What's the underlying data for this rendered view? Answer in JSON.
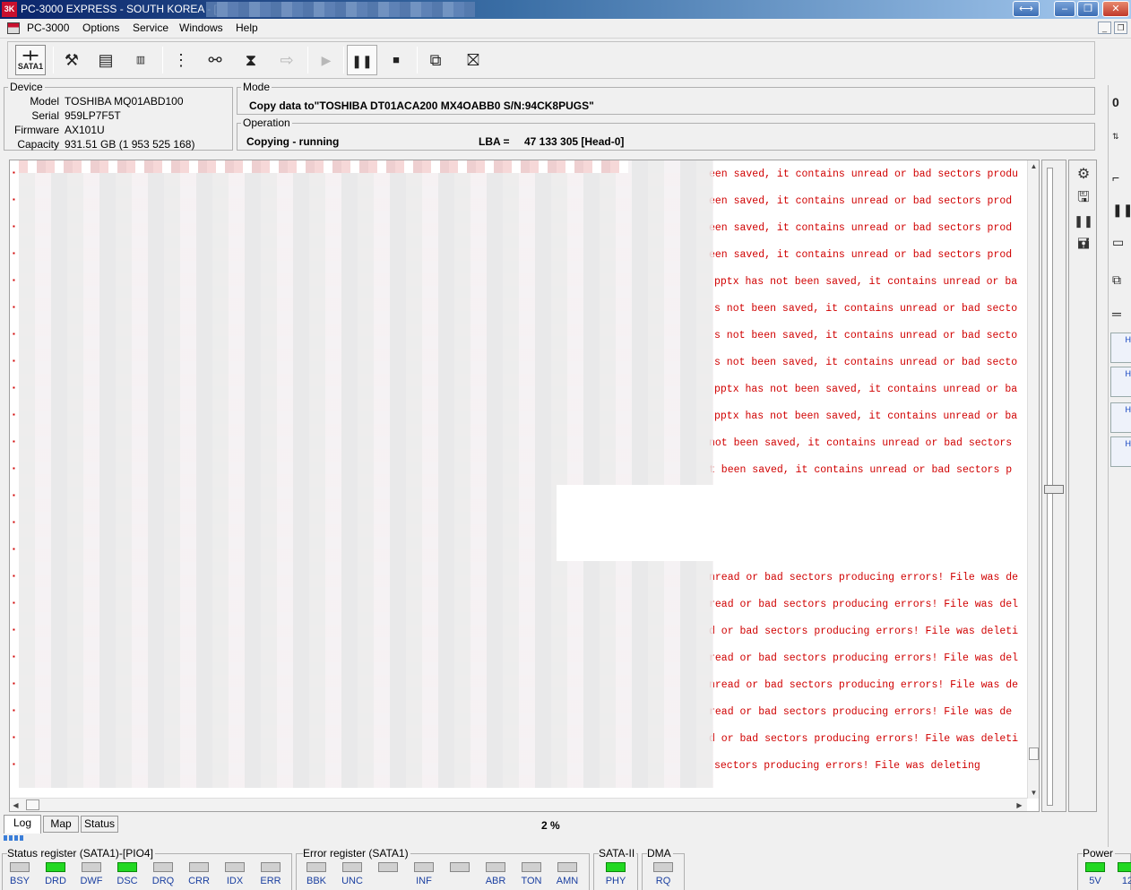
{
  "window": {
    "title": "PC-3000 EXPRESS - SOUTH KOREA - [",
    "logo_text": "3K"
  },
  "menu": [
    "PC-3000",
    "Options",
    "Service",
    "Windows",
    "Help"
  ],
  "toolbar": {
    "sata_label": "SATA1"
  },
  "device": {
    "legend": "Device",
    "model_label": "Model",
    "model": "TOSHIBA MQ01ABD100",
    "serial_label": "Serial",
    "serial": "959LP7F5T",
    "firmware_label": "Firmware",
    "firmware": "AX101U",
    "capacity_label": "Capacity",
    "capacity": "931.51 GB (1 953 525 168)"
  },
  "mode": {
    "legend": "Mode",
    "value": "Copy data to\"TOSHIBA DT01ACA200 MX4OABB0 S/N:94CK8PUGS\""
  },
  "operation": {
    "legend": "Operation",
    "status": "Copying - running",
    "lba_label": "LBA =",
    "lba_value": "47 133 305  [Head-0]"
  },
  "log": {
    "lines": [
      "een saved, it contains unread or bad sectors produ",
      "een saved, it contains unread or bad sectors prod",
      "een saved, it contains unread or bad sectors prod",
      "een saved, it contains unread or bad sectors prod",
      "pptx has not been saved, it contains unread or ba",
      "s not been saved, it contains unread or bad secto",
      "s not been saved, it contains unread or bad secto",
      "s not been saved, it contains unread or bad secto",
      "pptx has not been saved, it contains unread or ba",
      "pptx has not been saved, it contains unread or ba",
      "not been saved, it contains unread or bad sectors",
      "t been saved, it contains unread or bad sectors p",
      "",
      "",
      "",
      "nread or bad sectors producing errors! File was de",
      "read or bad sectors producing errors! File was del",
      "d or bad sectors producing errors! File was deleti",
      "read or bad sectors producing errors! File was del",
      "nread or bad sectors producing errors! File was de",
      "read or bad sectors producing errors! File was de",
      "d or bad sectors producing errors! File was deleti",
      " sectors producing errors! File was deleting"
    ]
  },
  "tabs": [
    "Log",
    "Map",
    "Status"
  ],
  "progress": {
    "label": "2 %",
    "value_percent": 2
  },
  "status_register": {
    "label": "Status register (SATA1)-[PIO4]",
    "flags": [
      {
        "name": "BSY",
        "on": false
      },
      {
        "name": "DRD",
        "on": true
      },
      {
        "name": "DWF",
        "on": false
      },
      {
        "name": "DSC",
        "on": true
      },
      {
        "name": "DRQ",
        "on": false
      },
      {
        "name": "CRR",
        "on": false
      },
      {
        "name": "IDX",
        "on": false
      },
      {
        "name": "ERR",
        "on": false
      }
    ]
  },
  "error_register": {
    "label": "Error register (SATA1)",
    "flags": [
      {
        "name": "BBK",
        "on": false
      },
      {
        "name": "UNC",
        "on": false
      },
      {
        "name": "",
        "on": false
      },
      {
        "name": "INF",
        "on": false
      },
      {
        "name": "",
        "on": false
      },
      {
        "name": "ABR",
        "on": false
      },
      {
        "name": "TON",
        "on": false
      },
      {
        "name": "AMN",
        "on": false
      }
    ]
  },
  "sata2": {
    "label": "SATA-II",
    "flag": {
      "name": "PHY",
      "on": true
    }
  },
  "dma": {
    "label": "DMA",
    "flag": {
      "name": "RQ",
      "on": false
    }
  },
  "power": {
    "label": "Power",
    "flags": [
      {
        "name": "5V",
        "on": true
      },
      {
        "name": "12",
        "on": true
      }
    ]
  },
  "colors": {
    "led_on": "#22d822",
    "log_text": "#d00000"
  }
}
